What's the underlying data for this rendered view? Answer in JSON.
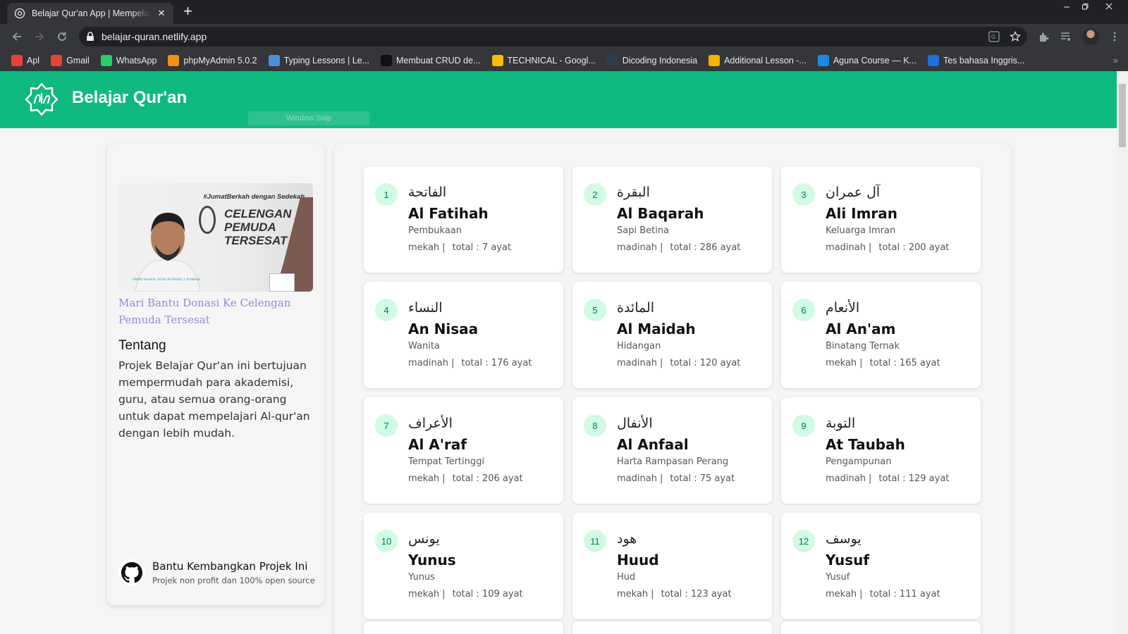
{
  "browser": {
    "tab_title": "Belajar Qur'an App | Mempelajari Al-Qur'an",
    "url": "belajar-quran.netlify.app",
    "bookmarks": [
      {
        "label": "Apl",
        "icon": "apps-grid-icon",
        "color": "#ea4335"
      },
      {
        "label": "Gmail",
        "icon": "gmail-icon",
        "color": "#ea4335"
      },
      {
        "label": "WhatsApp",
        "icon": "whatsapp-icon",
        "color": "#25d366"
      },
      {
        "label": "phpMyAdmin 5.0.2",
        "icon": "phpmyadmin-icon",
        "color": "#f29111"
      },
      {
        "label": "Typing Lessons | Le...",
        "icon": "typing-icon",
        "color": "#4a90d9"
      },
      {
        "label": "Membuat CRUD de...",
        "icon": "video-icon",
        "color": "#111111"
      },
      {
        "label": "TECHNICAL - Googl...",
        "icon": "google-drive-icon",
        "color": "#fbbc04"
      },
      {
        "label": "Dicoding Indonesia",
        "icon": "dicoding-icon",
        "color": "#2d3e50"
      },
      {
        "label": "Additional Lesson -...",
        "icon": "slides-icon",
        "color": "#f4b400"
      },
      {
        "label": "Aguna Course — K...",
        "icon": "aguna-icon",
        "color": "#1e88e5"
      },
      {
        "label": "Tes bahasa Inggris...",
        "icon": "ef-icon",
        "color": "#1e6fd9"
      }
    ]
  },
  "app": {
    "title": "Belajar Qur'an",
    "overlay": "Window Snip",
    "brand_color": "#10b981"
  },
  "sidebar": {
    "banner": {
      "tag": "#JumatBerkah dengan Sedekah",
      "headline": "CELENGAN PEMUDA TERSESAT",
      "caption": "Habib Husein Ja'far Al-Hadar x Kitabisa"
    },
    "donation_link": "Mari Bantu Donasi Ke Celengan Pemuda Tersesat",
    "about_title": "Tentang",
    "about_text": "Projek Belajar Qur'an ini bertujuan mempermudah para akademisi, guru, atau semua orang-orang untuk dapat mempelajari Al-qur'an dengan lebih mudah.",
    "github_title": "Bantu Kembangkan Projek Ini",
    "github_subtitle": "Projek non profit dan 100% open source"
  },
  "surahs": [
    {
      "number": "1",
      "arabic": "الفاتحة",
      "name": "Al Fatihah",
      "meaning": "Pembukaan",
      "type": "mekah",
      "total": "total : 7 ayat"
    },
    {
      "number": "2",
      "arabic": "البقرة",
      "name": "Al Baqarah",
      "meaning": "Sapi Betina",
      "type": "madinah",
      "total": "total : 286 ayat"
    },
    {
      "number": "3",
      "arabic": "آل عمران",
      "name": "Ali Imran",
      "meaning": "Keluarga Imran",
      "type": "madinah",
      "total": "total : 200 ayat"
    },
    {
      "number": "4",
      "arabic": "النساء",
      "name": "An Nisaa",
      "meaning": "Wanita",
      "type": "madinah",
      "total": "total : 176 ayat"
    },
    {
      "number": "5",
      "arabic": "المائدة",
      "name": "Al Maidah",
      "meaning": "Hidangan",
      "type": "madinah",
      "total": "total : 120 ayat"
    },
    {
      "number": "6",
      "arabic": "الأنعام",
      "name": "Al An'am",
      "meaning": "Binatang Ternak",
      "type": "mekah",
      "total": "total : 165 ayat"
    },
    {
      "number": "7",
      "arabic": "الأعراف",
      "name": "Al A'raf",
      "meaning": "Tempat Tertinggi",
      "type": "mekah",
      "total": "total : 206 ayat"
    },
    {
      "number": "8",
      "arabic": "الأنفال",
      "name": "Al Anfaal",
      "meaning": "Harta Rampasan Perang",
      "type": "madinah",
      "total": "total : 75 ayat"
    },
    {
      "number": "9",
      "arabic": "التوبة",
      "name": "At Taubah",
      "meaning": "Pengampunan",
      "type": "madinah",
      "total": "total : 129 ayat"
    },
    {
      "number": "10",
      "arabic": "يونس",
      "name": "Yunus",
      "meaning": "Yunus",
      "type": "mekah",
      "total": "total : 109 ayat"
    },
    {
      "number": "11",
      "arabic": "هود",
      "name": "Huud",
      "meaning": "Hud",
      "type": "mekah",
      "total": "total : 123 ayat"
    },
    {
      "number": "12",
      "arabic": "يوسف",
      "name": "Yusuf",
      "meaning": "Yusuf",
      "type": "mekah",
      "total": "total : 111 ayat"
    }
  ]
}
